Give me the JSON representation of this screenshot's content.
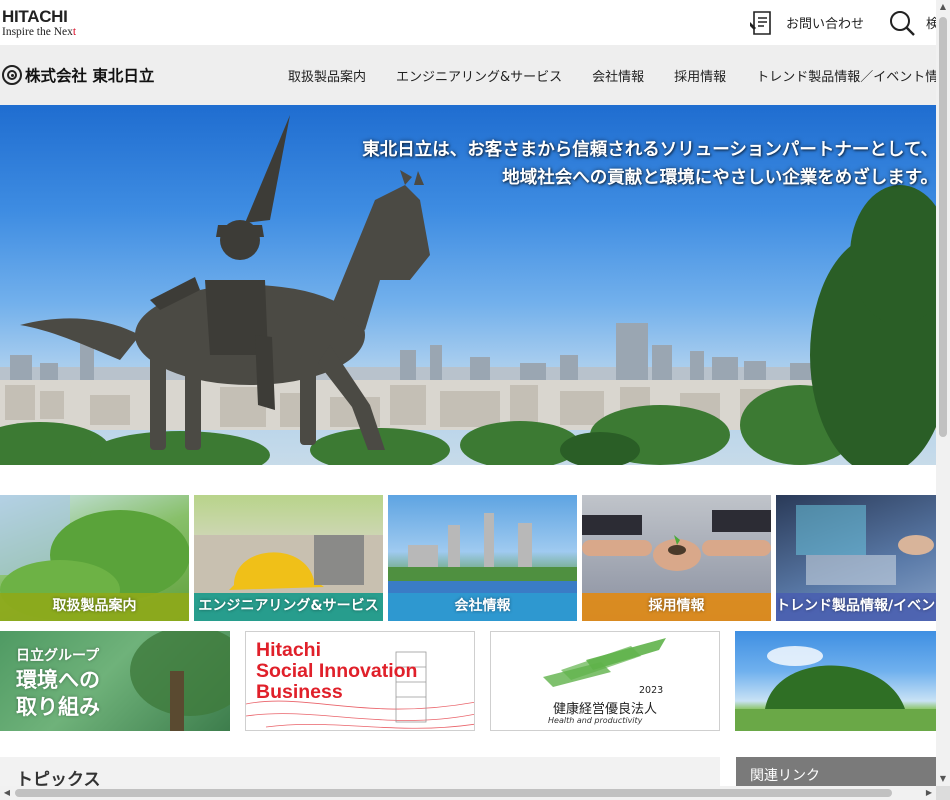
{
  "header": {
    "brand": "HITACHI",
    "tagline_prefix": "Inspire the Nex",
    "tagline_accent": "t",
    "contact_label": "お問い合わせ",
    "contact_icon": "contact-form-icon",
    "search_label": "検",
    "search_icon": "search-icon"
  },
  "company": {
    "name": "株式会社 東北日立"
  },
  "nav": {
    "items": [
      {
        "label": "取扱製品案内"
      },
      {
        "label": "エンジニアリング&サービス"
      },
      {
        "label": "会社情報"
      },
      {
        "label": "採用情報"
      },
      {
        "label": "トレンド製品情報／イベント情"
      }
    ]
  },
  "hero": {
    "line1": "東北日立は、お客さまから信頼されるソリューションパートナーとして、",
    "line2": "地域社会への貢献と環境にやさしい企業をめざします。"
  },
  "tiles": [
    {
      "label": "取扱製品案内"
    },
    {
      "label": "エンジニアリング&サービス"
    },
    {
      "label": "会社情報"
    },
    {
      "label": "採用情報"
    },
    {
      "label": "トレンド製品情報/イベント"
    }
  ],
  "banners": {
    "environment": {
      "line1": "日立グループ",
      "line2": "環境への",
      "line3": "取り組み"
    },
    "social": {
      "line1": "Hitachi",
      "line2": "Social Innovation",
      "line3": "Business"
    },
    "health": {
      "year": "2023",
      "title": "健康経営優良法人",
      "subtitle": "Health and productivity"
    }
  },
  "sections": {
    "topics": "トピックス",
    "related": "関連リンク"
  },
  "colors": {
    "brand_red": "#d8001c",
    "nav_bg": "#eeeeee",
    "tile_products": "#8ea91a",
    "tile_engineering": "#1a9a8a",
    "tile_company": "#2e9ad0",
    "tile_recruit": "#e08a16",
    "tile_trend": "#4a5fb0"
  }
}
